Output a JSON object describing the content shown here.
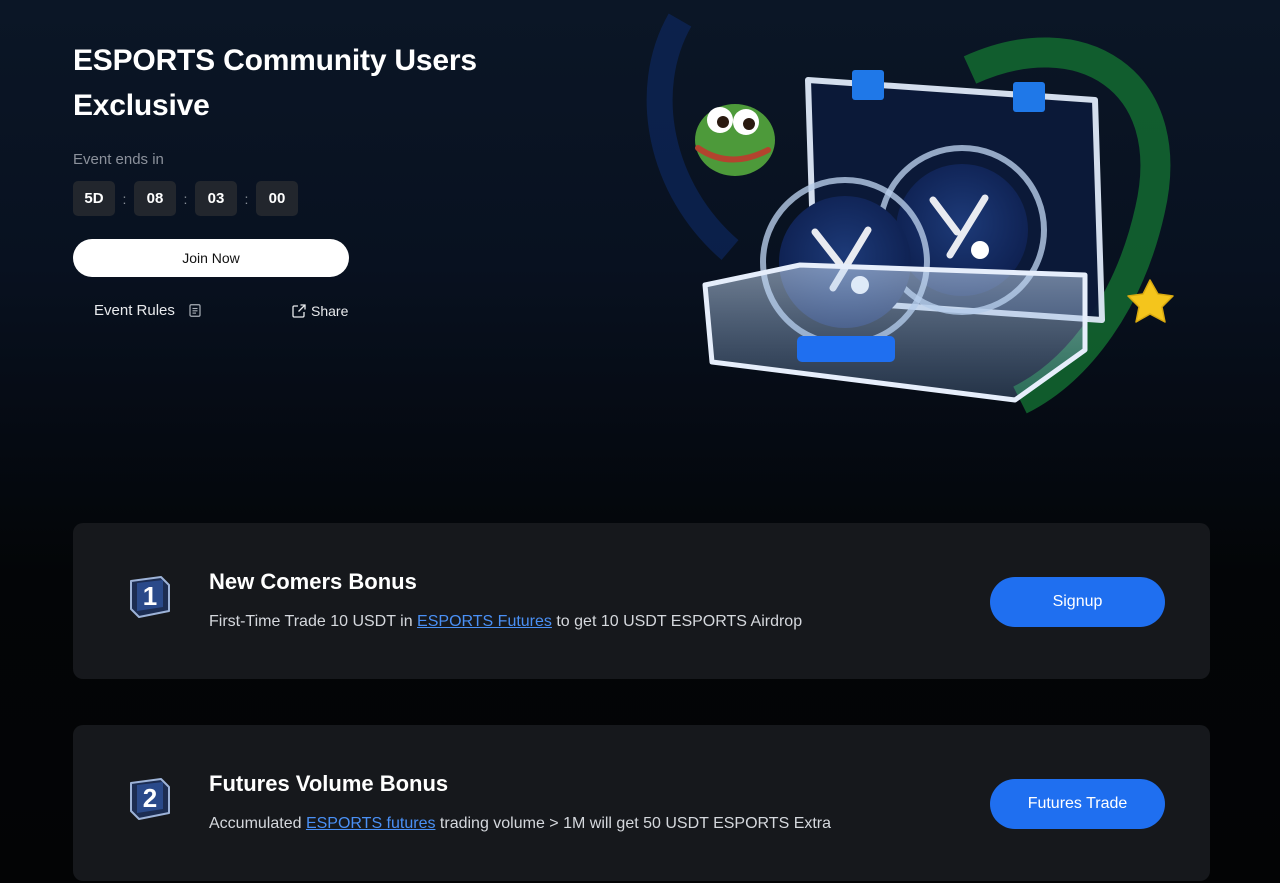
{
  "hero": {
    "title": "ESPORTS Community Users Exclusive",
    "ends_label": "Event ends in",
    "countdown": {
      "days": "5D",
      "hours": "08",
      "minutes": "03",
      "seconds": "00",
      "separator": ":"
    },
    "join_label": "Join Now",
    "rules_label": "Event Rules",
    "share_label": "Share"
  },
  "tasks": [
    {
      "number": "1",
      "title": "New Comers Bonus",
      "desc_before": "First-Time Trade 10 USDT in ",
      "desc_link": "ESPORTS Futures",
      "desc_after": " to get 10 USDT ESPORTS Airdrop",
      "button_label": "Signup"
    },
    {
      "number": "2",
      "title": "Futures Volume Bonus",
      "desc_before": "Accumulated ",
      "desc_link": "ESPORTS futures",
      "desc_after": " trading volume > 1M will get 50 USDT ESPORTS Extra",
      "button_label": "Futures Trade"
    }
  ],
  "colors": {
    "accent_blue": "#1f6ff0",
    "link_blue": "#4a90f5",
    "card_bg": "#16181c",
    "countdown_bg": "#22262d"
  },
  "icons": [
    "document-icon",
    "share-external-icon",
    "number-one-badge-icon",
    "number-two-badge-icon",
    "frog-mascot-icon",
    "star-icon",
    "coin-logo-icon"
  ]
}
